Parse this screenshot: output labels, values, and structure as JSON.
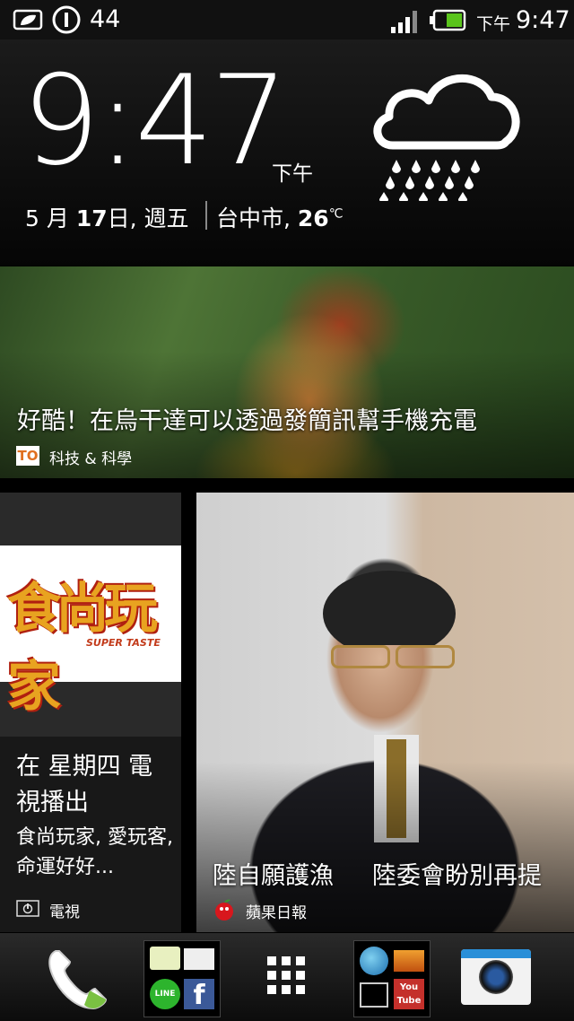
{
  "status_bar": {
    "notification_count": "44",
    "time_period": "下午",
    "time": "9:47",
    "icons": [
      "leaf-message-icon",
      "power-icon",
      "signal-icon",
      "battery-icon"
    ],
    "battery_color": "#5ac41c"
  },
  "clock_widget": {
    "time": "9:47",
    "period": "下午",
    "date_month": "5 月",
    "date_day": "17",
    "date_rest": "日, 週五",
    "city": "台中市,",
    "temperature": "26",
    "temperature_unit": "℃",
    "weather_icon": "rain-cloud-icon"
  },
  "news_tile": {
    "headline": "好酷！在烏干達可以透過發簡訊幫手機充電",
    "source_icon": "TO",
    "category": "科技 & 科學"
  },
  "tv_tile": {
    "logo_text": "食尚玩家",
    "logo_subtext": "SUPER TASTE",
    "schedule": "在 星期四 電視播出",
    "description": "食尚玩家, 愛玩客, 命運好好...",
    "category": "電視"
  },
  "apple_tile": {
    "headline_part1": "陸自願護漁",
    "headline_part2": "陸委會盼別再提",
    "source": "蘋果日報"
  },
  "dock": {
    "apps": [
      "phone-icon",
      "messaging-folder-icon",
      "app-drawer-icon",
      "media-folder-icon",
      "camera-icon"
    ],
    "folder1_line_label": "LINE",
    "folder2_youtube_label": "You Tube"
  }
}
